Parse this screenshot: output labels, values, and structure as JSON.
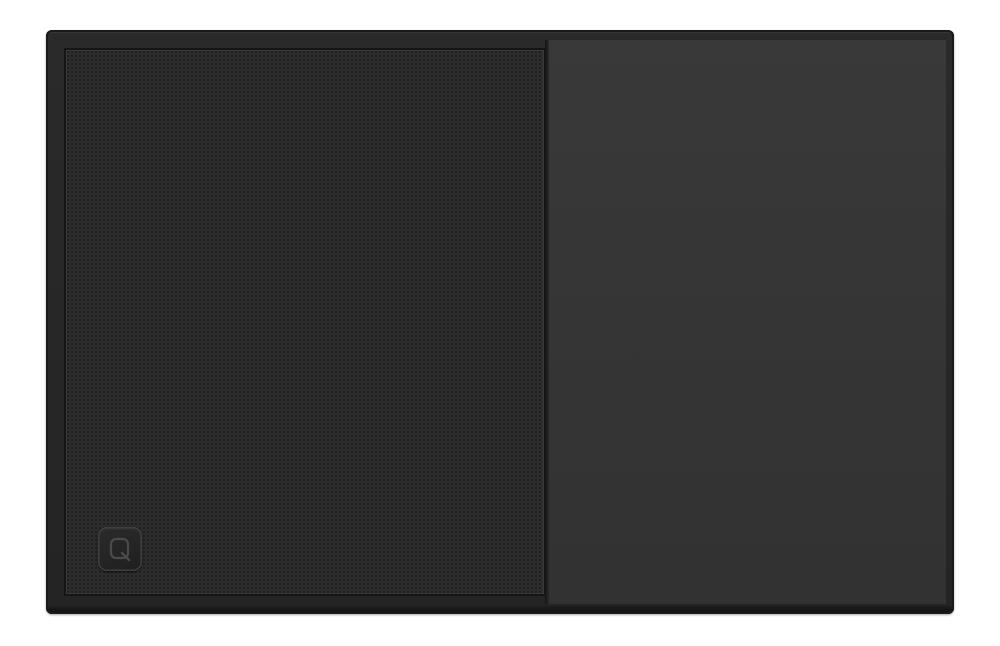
{
  "image": {
    "subject": "speaker",
    "colors": {
      "background": "#ffffff",
      "enclosure": "#262626",
      "grille": "#2d2d2d",
      "panel": "#373737",
      "badge": "#242424"
    },
    "icons": {
      "logo": "q-logo-icon"
    }
  }
}
